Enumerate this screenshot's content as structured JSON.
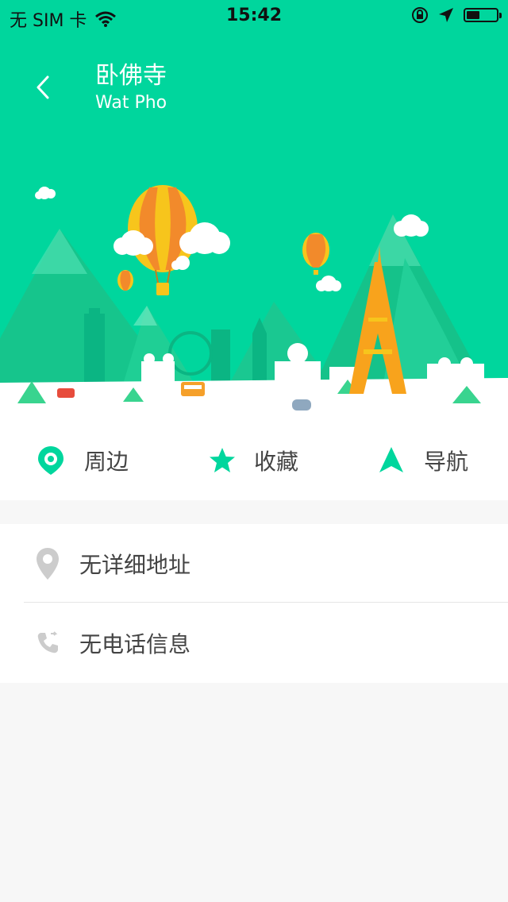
{
  "status_bar": {
    "carrier": "无 SIM 卡",
    "time": "15:42",
    "battery_level": 0.45,
    "icons": [
      "wifi-icon",
      "orientation-lock-icon",
      "location-arrow-icon",
      "battery-icon"
    ]
  },
  "header": {
    "title": "卧佛寺",
    "subtitle": "Wat Pho",
    "back_icon": "chevron-left-icon"
  },
  "actions": [
    {
      "label": "周边",
      "icon": "location-pin-icon"
    },
    {
      "label": "收藏",
      "icon": "star-icon"
    },
    {
      "label": "导航",
      "icon": "navigation-arrow-icon"
    }
  ],
  "info": {
    "address": {
      "text": "无详细地址",
      "icon": "map-pin-icon"
    },
    "phone": {
      "text": "无电话信息",
      "icon": "phone-icon"
    }
  },
  "colors": {
    "accent": "#00d69d",
    "text": "#444444",
    "icon_gray": "#cccccc",
    "background": "#f7f7f7"
  }
}
